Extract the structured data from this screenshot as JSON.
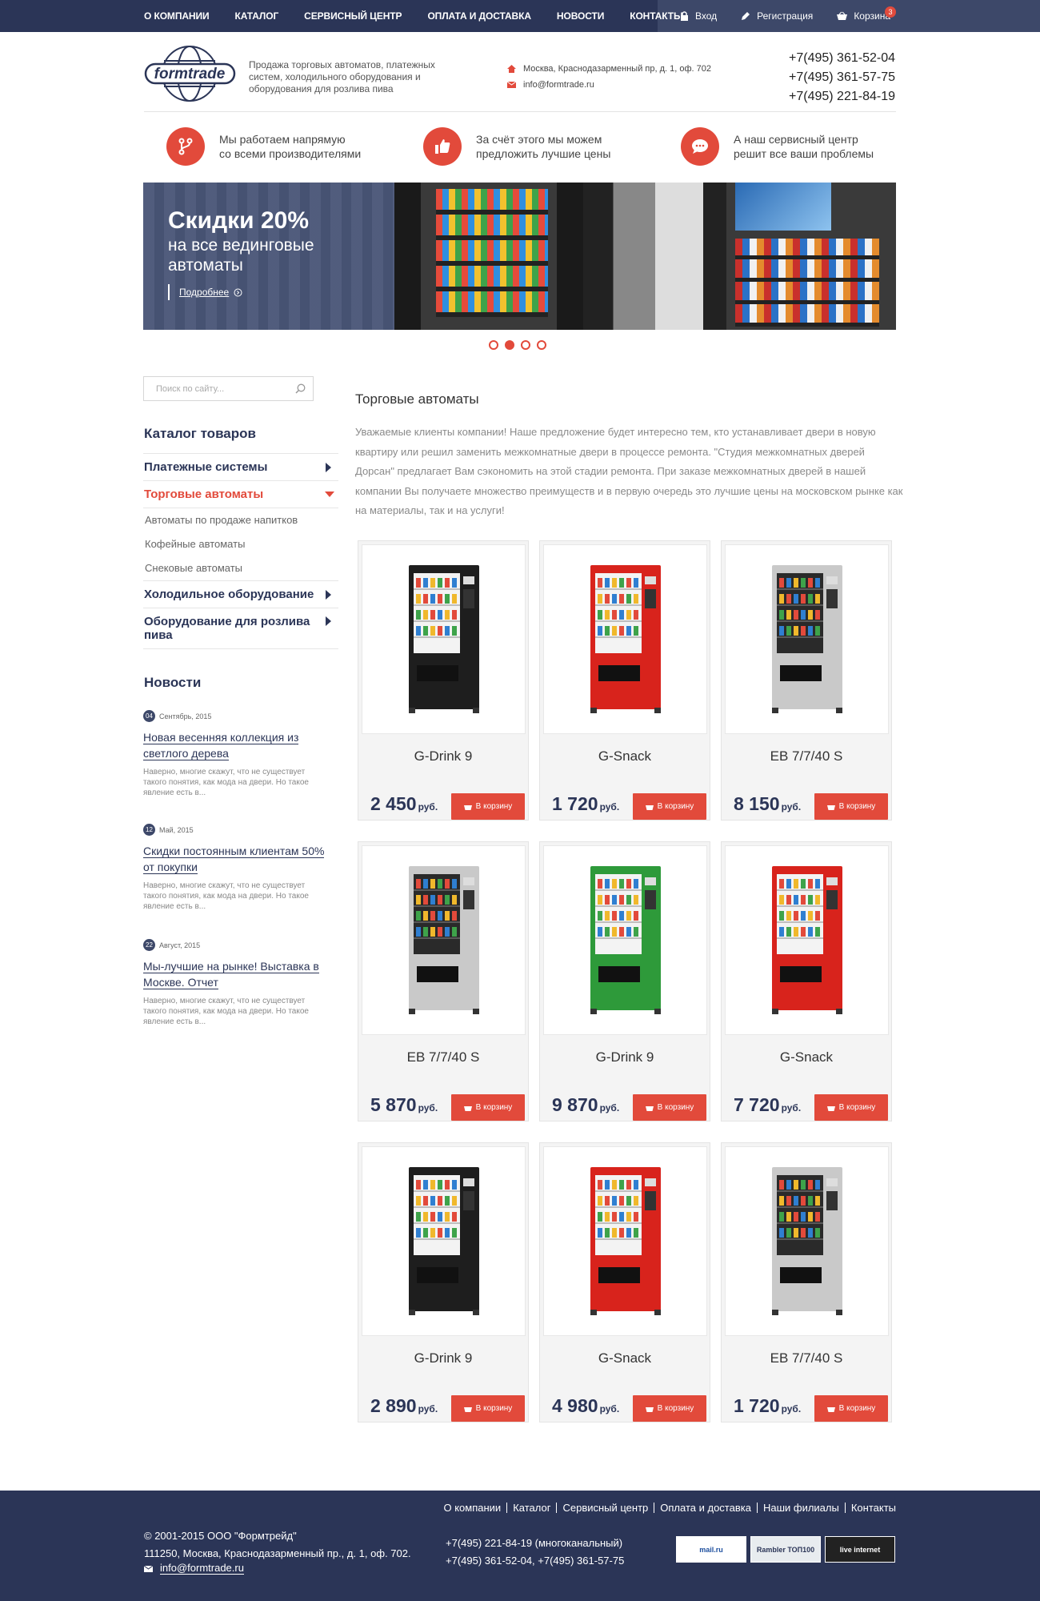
{
  "topnav": {
    "items": [
      "О КОМПАНИИ",
      "КАТАЛОГ",
      "СЕРВИСНЫЙ ЦЕНТР",
      "ОПЛАТА И ДОСТАВКА",
      "НОВОСТИ",
      "КОНТАКТЫ"
    ]
  },
  "user": {
    "login": "Вход",
    "register": "Регистрация",
    "cart": "Корзина",
    "cart_count": "3"
  },
  "header": {
    "logo": "formtrade",
    "tagline": "Продажа торговых автоматов, платежных систем, холодильного оборудования и оборудования для розлива пива",
    "address": "Москва, Краснодазарменный пр, д. 1, оф. 702",
    "email": "info@formtrade.ru",
    "phones": [
      "+7(495) 361-52-04",
      "+7(495) 361-57-75",
      "+7(495) 221-84-19"
    ]
  },
  "features": [
    {
      "icon": "branch-icon",
      "text1": "Мы работаем напрямую",
      "text2": "со всеми производителями"
    },
    {
      "icon": "thumbs-up-icon",
      "text1": "За счёт этого мы можем",
      "text2": "предложить лучшие цены"
    },
    {
      "icon": "chat-icon",
      "text1": "А наш сервисный центр",
      "text2": "решит все ваши проблемы"
    }
  ],
  "banner": {
    "title": "Скидки 20%",
    "subtitle": "на все вединговые автоматы",
    "more": "Подробнее"
  },
  "slider": {
    "count": 4,
    "active": 1
  },
  "search": {
    "placeholder": "Поиск по сайту..."
  },
  "catalog": {
    "title": "Каталог товаров",
    "items": [
      {
        "label": "Платежные системы"
      },
      {
        "label": "Торговые автоматы",
        "subs": [
          "Автоматы по продаже напитков",
          "Кофейные автоматы",
          "Снековые автоматы"
        ]
      },
      {
        "label": "Холодильное оборудование"
      },
      {
        "label": "Оборудование для розлива пива"
      }
    ]
  },
  "news": {
    "title": "Новости",
    "items": [
      {
        "day": "04",
        "month": "Сентябрь, 2015",
        "head": "Новая весенняя коллекция из светлого дерева",
        "text": "Наверно, многие скажут, что не существует такого понятия, как мода на двери. Но такое явление есть в..."
      },
      {
        "day": "12",
        "month": "Май, 2015",
        "head": "Скидки постоянным клиентам 50% от покупки",
        "text": "Наверно, многие скажут, что не существует такого понятия, как мода на двери. Но такое явление есть в..."
      },
      {
        "day": "22",
        "month": "Август, 2015",
        "head": "Мы-лучшие на рынке! Выставка в Москве. Отчет",
        "text": "Наверно, многие скажут, что не существует такого понятия, как мода на двери. Но такое явление есть в..."
      }
    ]
  },
  "main": {
    "title": "Торговые автоматы",
    "intro": "Уважаемые клиенты компании! Наше предложение будет интересно тем, кто устанавливает двери в новую квартиру или решил заменить межкомнатные двери в процессе ремонта. \"Студия межкомнатных дверей Дорсан\" предлагает Вам сэкономить на этой стадии ремонта. При заказе межкомнатных дверей в нашей компании Вы получаете множество преимуществ и в первую очередь это лучшие цены на московском рынке как на материалы, так и на услуги!",
    "currency": "руб.",
    "buy_label": "В корзину",
    "products": [
      {
        "name": "G-Drink 9",
        "price": "2 450",
        "color": "#1e1e1e"
      },
      {
        "name": "G-Snack",
        "price": "1 720",
        "color": "#d8231c"
      },
      {
        "name": "EB 7/7/40 S",
        "price": "8 150",
        "color": "#c9c9c9"
      },
      {
        "name": "EB 7/7/40 S",
        "price": "5 870",
        "color": "#c9c9c9"
      },
      {
        "name": "G-Drink 9",
        "price": "9 870",
        "color": "#2e9a3a"
      },
      {
        "name": "G-Snack",
        "price": "7 720",
        "color": "#d8231c"
      },
      {
        "name": "G-Drink 9",
        "price": "2 890",
        "color": "#1e1e1e"
      },
      {
        "name": "G-Snack",
        "price": "4 980",
        "color": "#d8231c"
      },
      {
        "name": "EB 7/7/40 S",
        "price": "1 720",
        "color": "#c9c9c9"
      }
    ]
  },
  "footer": {
    "nav": [
      "О компании",
      "Каталог",
      "Сервисный центр",
      "Оплата и доставка",
      "Наши филиалы",
      "Контакты"
    ],
    "copyright": "© 2001-2015 ООО \"Формтрейд\"",
    "address": "111250, Москва, Краснодазарменный пр., д. 1, оф. 702.",
    "email": "info@formtrade.ru",
    "phone1": "+7(495) 221-84-19 (многоканальный)",
    "phone2": "+7(495) 361-52-04, +7(495) 361-57-75",
    "counters": [
      "mail.ru",
      "Rambler ТОП100",
      "live internet"
    ]
  },
  "colors": {
    "navy": "#2b3557",
    "accent": "#e24a3b"
  }
}
